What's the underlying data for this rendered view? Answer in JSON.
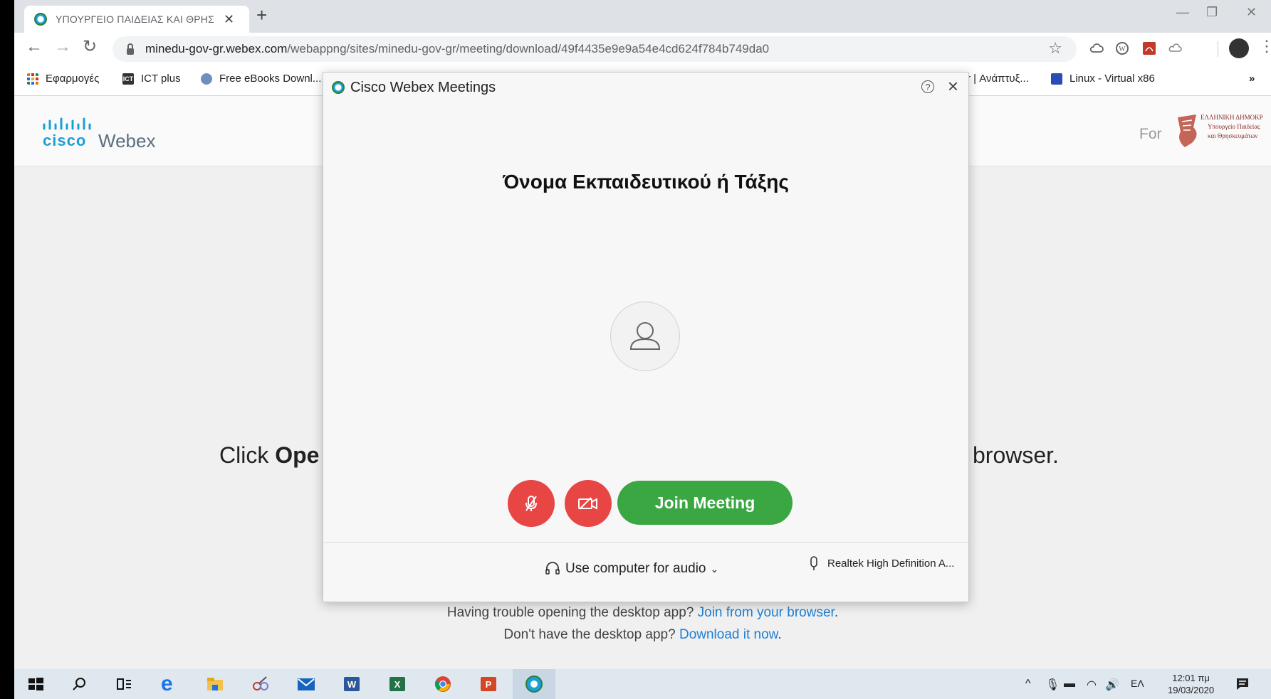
{
  "browser": {
    "tab_title": "ΥΠΟΥΡΓΕΙΟ ΠΑΙΔΕΙΑΣ ΚΑΙ ΘΡΗΣ",
    "url_host": "minedu-gov-gr.webex.com",
    "url_path": "/webappng/sites/minedu-gov-gr/meeting/download/49f4435e9e9a54e4cd624f784b749da0",
    "bookmarks": [
      "Εφαρμογές",
      "ICT plus",
      "Free eBooks Downl...",
      "r | Ανάπτυξ...",
      "Linux - Virtual x86"
    ]
  },
  "page": {
    "brand_cisco": "cisco",
    "brand_webex": "Webex",
    "for_label": "For",
    "gov_lines": [
      "ΕΛΛΗΝΙΚΗ ΔΗΜΟΚΡ",
      "Υπουργείο Παιδείας",
      "και Θρησκευμάτων"
    ],
    "instruction_prefix": "Click ",
    "instruction_bold": "Ope",
    "instruction_suffix": "browser.",
    "trouble_text": "Having trouble opening the desktop app? ",
    "trouble_link": "Join from your browser",
    "trouble_end": ".",
    "no_app_text": "Don't have the desktop app? ",
    "no_app_link": "Download it now",
    "no_app_end": "."
  },
  "dialog": {
    "title": "Cisco Webex Meetings",
    "help_glyph": "?",
    "meeting_name": "Όνομα Εκπαιδευτικού ή Τάξης",
    "join_label": "Join Meeting",
    "audio_option": "Use computer for audio",
    "mic_device": "Realtek High Definition A..."
  },
  "taskbar": {
    "language": "ΕΛ",
    "time": "12:01 πμ",
    "date": "19/03/2020"
  },
  "colors": {
    "accent_green": "#3aa743",
    "mute_red": "#e84545",
    "link_blue": "#1d7fd6",
    "cisco_blue": "#1ba0d7"
  }
}
